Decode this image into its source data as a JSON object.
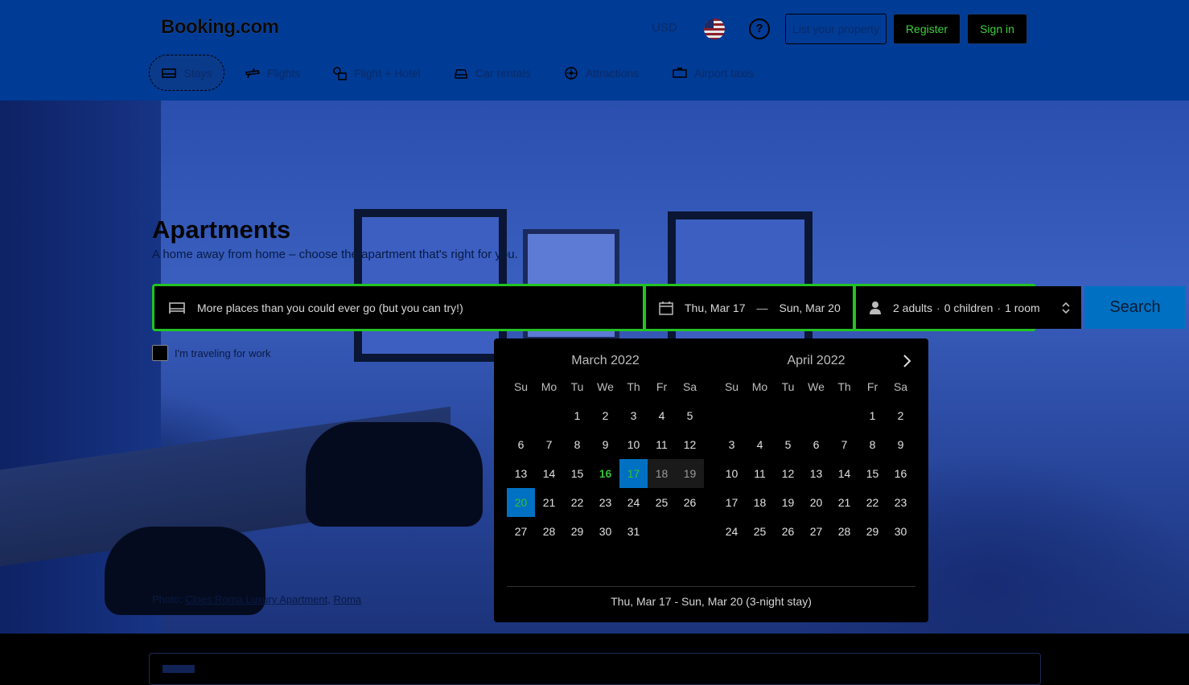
{
  "header": {
    "logo": "Booking.com",
    "currency": "USD",
    "help_label": "?",
    "list_property": "List your property",
    "register": "Register",
    "sign_in": "Sign in"
  },
  "nav": {
    "items": [
      {
        "label": "Stays",
        "icon": "bed-icon"
      },
      {
        "label": "Flights",
        "icon": "plane-icon"
      },
      {
        "label": "Flight + Hotel",
        "icon": "flight-hotel-icon"
      },
      {
        "label": "Car rentals",
        "icon": "car-icon"
      },
      {
        "label": "Attractions",
        "icon": "attractions-icon"
      },
      {
        "label": "Airport taxis",
        "icon": "taxi-icon"
      }
    ]
  },
  "hero": {
    "title": "Apartments",
    "subtitle": "A home away from home – choose the apartment that's right for you.",
    "photo_prefix": "Photo: ",
    "photo_name": "Cloes Roma Luxury Apartment",
    "photo_sep": ", ",
    "photo_city": "Roma"
  },
  "search": {
    "destination_placeholder": "More places than you could ever go (but you can try!)",
    "checkin": "Thu, Mar 17",
    "dash": "—",
    "checkout": "Sun, Mar 20",
    "adults": "2 adults",
    "children": "0 children",
    "rooms": "1 room",
    "sep": "·",
    "button": "Search",
    "work_travel": "I'm traveling for work"
  },
  "calendar": {
    "weekdays": [
      "Su",
      "Mo",
      "Tu",
      "We",
      "Th",
      "Fr",
      "Sa"
    ],
    "months": [
      {
        "title": "March 2022",
        "weeks": [
          [
            "",
            "",
            "1",
            "2",
            "3",
            "4",
            "5"
          ],
          [
            "6",
            "7",
            "8",
            "9",
            "10",
            "11",
            "12"
          ],
          [
            "13",
            "14",
            "15",
            "16",
            "17",
            "18",
            "19"
          ],
          [
            "20",
            "21",
            "22",
            "23",
            "24",
            "25",
            "26"
          ],
          [
            "27",
            "28",
            "29",
            "30",
            "31",
            "",
            ""
          ]
        ]
      },
      {
        "title": "April 2022",
        "weeks": [
          [
            "",
            "",
            "",
            "",
            "",
            "1",
            "2"
          ],
          [
            "3",
            "4",
            "5",
            "6",
            "7",
            "8",
            "9"
          ],
          [
            "10",
            "11",
            "12",
            "13",
            "14",
            "15",
            "16"
          ],
          [
            "17",
            "18",
            "19",
            "20",
            "21",
            "22",
            "23"
          ],
          [
            "24",
            "25",
            "26",
            "27",
            "28",
            "29",
            "30"
          ]
        ]
      }
    ],
    "today": "16",
    "selected_start": "17",
    "selected_end": "20",
    "in_range": [
      "18",
      "19"
    ],
    "footer": "Thu, Mar 17 - Sun, Mar 20 (3-night stay)"
  },
  "colors": {
    "header_bg": "#003b95",
    "accent_green": "#22c322",
    "search_button": "#0071c2"
  }
}
